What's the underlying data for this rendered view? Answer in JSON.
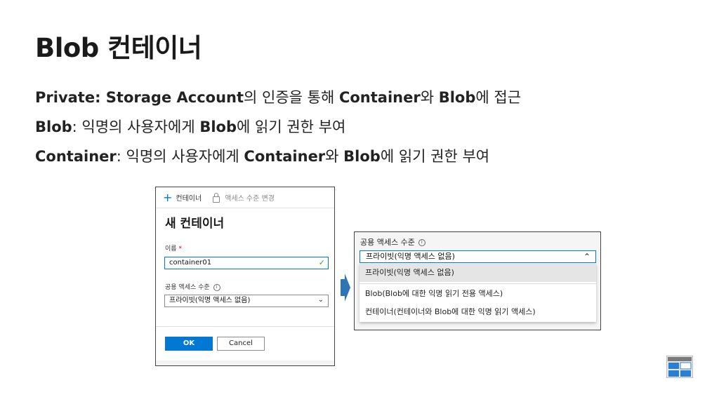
{
  "title": "Blob 컨테이너",
  "lines": [
    {
      "term": "Private: Storage Account",
      "text1": "의 인증을 통해 ",
      "b2": "Container",
      "text2": "와 ",
      "b3": "Blob",
      "text3": "에 접근"
    },
    {
      "term": "Blob",
      "text1": ": 익명의 사용자에게 ",
      "b2": "Blob",
      "text2": "에 읽기 권한 부여"
    },
    {
      "term": "Container",
      "text1": ": 익명의 사용자에게 ",
      "b2": "Container",
      "text2": "와 ",
      "b3": "Blob",
      "text3": "에 읽기 권한 부여"
    }
  ],
  "panel1": {
    "toolbar": {
      "add_container": "컨테이너",
      "change_access": "액세스 수준 변경"
    },
    "heading": "새 컨테이너",
    "name_label": "이름",
    "required_mark": "*",
    "name_value": "container01",
    "access_label": "공용 액세스 수준",
    "access_value": "프라이빗(익명 액세스 없음)",
    "ok_label": "OK",
    "cancel_label": "Cancel"
  },
  "panel2": {
    "label": "공용 액세스 수준",
    "selected": "프라이빗(익명 액세스 없음)",
    "options": [
      "프라이빗(익명 액세스 없음)",
      "Blob(Blob에 대한 익명 읽기 전용 액세스)",
      "컨테이너(컨테이너와 Blob에 대한 익명 읽기 액세스)"
    ]
  },
  "colors": {
    "accent": "#0078d4",
    "arrow": "#2e75b6"
  },
  "icons": {
    "add": "plus-icon",
    "lock": "lock-icon",
    "info": "info-icon",
    "check": "checkmark-icon",
    "chevron": "chevron-down-icon",
    "caret": "chevron-up-icon",
    "arrow": "right-arrow-icon",
    "logo": "storage-logo-icon"
  }
}
